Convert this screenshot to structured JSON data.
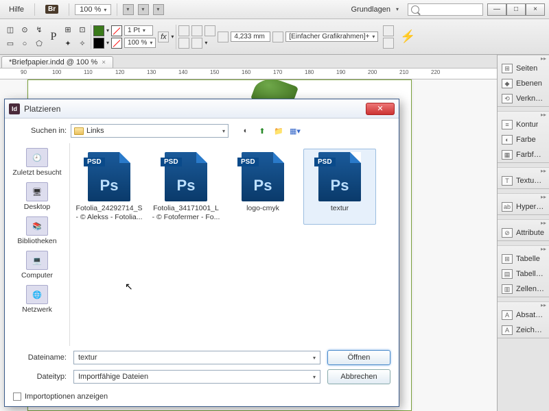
{
  "topbar": {
    "help": "Hilfe",
    "bridge_badge": "Br",
    "zoom": "100 %",
    "workspace_switcher": "Grundlagen"
  },
  "window_controls": {
    "min": "—",
    "max": "□",
    "close": "×"
  },
  "ctrlbar": {
    "stroke_weight": "1 Pt",
    "scale_pct": "100 %",
    "dimension": "4,233 mm",
    "frame_fitting": "[Einfacher Grafikrahmen]+"
  },
  "document_tab": "*Briefpapier.indd @ 100 %",
  "ruler_marks": [
    "90",
    "100",
    "110",
    "120",
    "130",
    "140",
    "150",
    "160",
    "170",
    "180",
    "190",
    "200",
    "210",
    "220"
  ],
  "panels": [
    {
      "group": [
        {
          "icon": "⊞",
          "label": "Seiten"
        },
        {
          "icon": "◆",
          "label": "Ebenen"
        },
        {
          "icon": "⟲",
          "label": "Verknüpf..."
        }
      ]
    },
    {
      "group": [
        {
          "icon": "≡",
          "label": "Kontur"
        },
        {
          "icon": "◐",
          "label": "Farbe"
        },
        {
          "icon": "▦",
          "label": "Farbfelder"
        }
      ]
    },
    {
      "group": [
        {
          "icon": "T",
          "label": "Textumfl..."
        }
      ]
    },
    {
      "group": [
        {
          "icon": "ab",
          "label": "Hyperlinks"
        }
      ]
    },
    {
      "group": [
        {
          "icon": "⊘",
          "label": "Attribute"
        }
      ]
    },
    {
      "group": [
        {
          "icon": "⊞",
          "label": "Tabelle"
        },
        {
          "icon": "▤",
          "label": "Tabellenf..."
        },
        {
          "icon": "▥",
          "label": "Zellenfor..."
        }
      ]
    },
    {
      "group": [
        {
          "icon": "A",
          "label": "Absatzfor..."
        },
        {
          "icon": "A",
          "label": "Zeichenf..."
        }
      ]
    }
  ],
  "dialog": {
    "title": "Platzieren",
    "lookup_label": "Suchen in:",
    "current_folder": "Links",
    "places": [
      {
        "label": "Zuletzt besucht"
      },
      {
        "label": "Desktop"
      },
      {
        "label": "Bibliotheken"
      },
      {
        "label": "Computer"
      },
      {
        "label": "Netzwerk"
      }
    ],
    "files": [
      {
        "name": "Fotolia_24292714_S - © Alekss - Fotolia...",
        "selected": false
      },
      {
        "name": "Fotolia_34171001_L - © Fotofermer - Fo...",
        "selected": false
      },
      {
        "name": "logo-cmyk",
        "selected": false
      },
      {
        "name": "textur",
        "selected": true
      }
    ],
    "filename_label": "Dateiname:",
    "filename_value": "textur",
    "filetype_label": "Dateityp:",
    "filetype_value": "Importfähige Dateien",
    "open_btn": "Öffnen",
    "cancel_btn": "Abbrechen",
    "import_options": "Importoptionen anzeigen"
  }
}
